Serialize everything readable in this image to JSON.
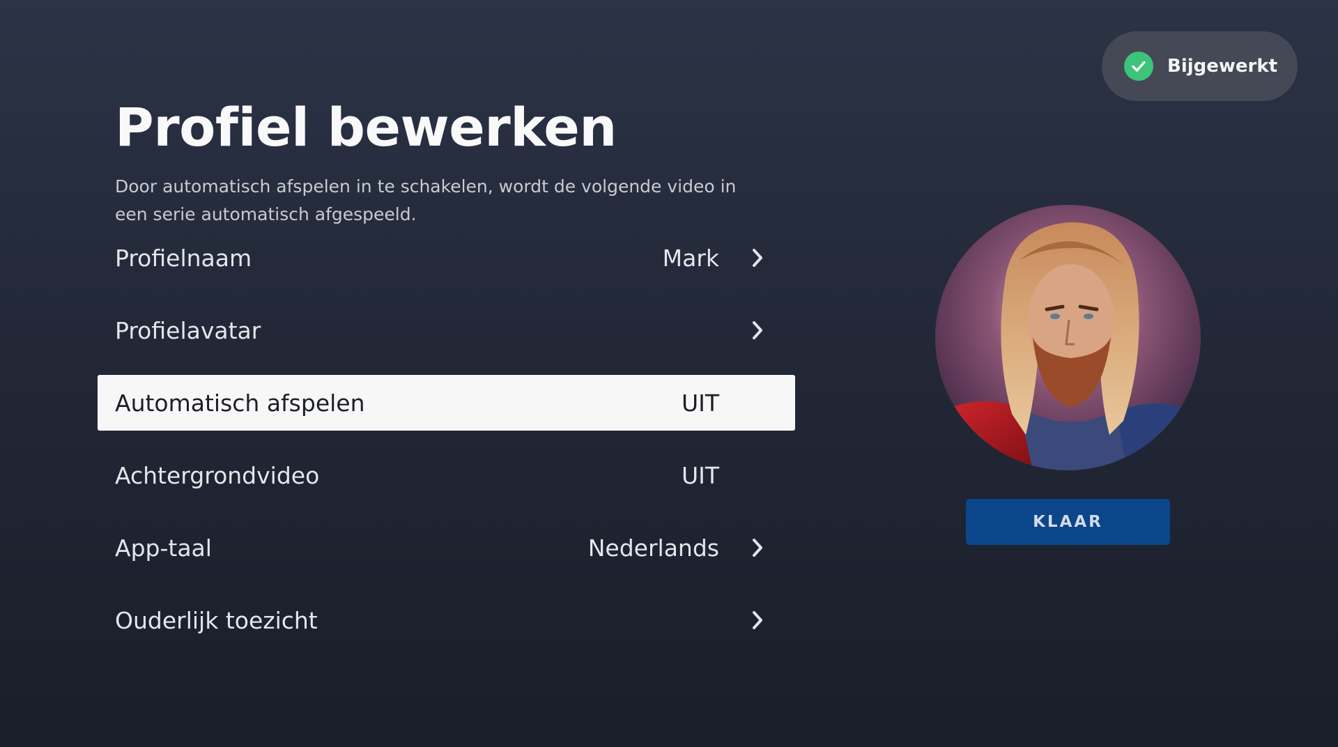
{
  "toast": {
    "label": "Bijgewerkt",
    "icon": "check-icon",
    "icon_color": "#3cc47a"
  },
  "page": {
    "title": "Profiel bewerken",
    "description": "Door automatisch afspelen in te schakelen, wordt de volgende video in een serie automatisch afgespeeld."
  },
  "menu": {
    "items": [
      {
        "label": "Profielnaam",
        "value": "Mark",
        "icon": "chevron-right-icon"
      },
      {
        "label": "Profielavatar",
        "value": "",
        "icon": "chevron-right-icon"
      },
      {
        "label": "Automatisch afspelen",
        "value": "UIT",
        "selected": true
      },
      {
        "label": "Achtergrondvideo",
        "value": "UIT"
      },
      {
        "label": "App-taal",
        "value": "Nederlands",
        "icon": "chevron-right-icon"
      },
      {
        "label": "Ouderlijk toezicht",
        "value": "",
        "icon": "chevron-right-icon"
      }
    ]
  },
  "avatar": {
    "description": "profile-avatar-image"
  },
  "done_button": {
    "label": "KLAAR",
    "color": "#0a4689"
  },
  "colors": {
    "background": "#222837",
    "selected_row": "#f7f7f7",
    "toast_bg": "#444955"
  }
}
